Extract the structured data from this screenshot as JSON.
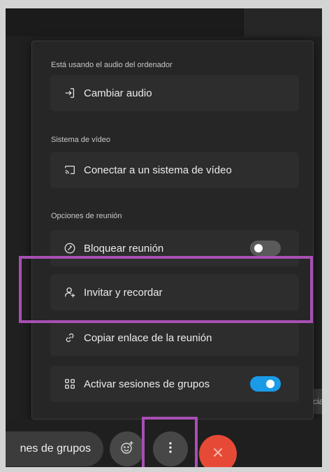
{
  "menu": {
    "audio_section": {
      "label": "Está usando el audio del ordenador",
      "item_label": "Cambiar audio",
      "icon": "switch-audio-icon"
    },
    "video_section": {
      "label": "Sistema de vídeo",
      "item_label": "Conectar a un sistema de vídeo",
      "icon": "cast-screen-icon"
    },
    "meeting_section": {
      "label": "Opciones de reunión",
      "items": [
        {
          "label": "Bloquear reunión",
          "icon": "lock-circle-icon",
          "toggle": "off"
        },
        {
          "label": "Invitar y recordar",
          "icon": "add-person-icon"
        },
        {
          "label": "Copiar enlace de la reunión",
          "icon": "link-icon"
        },
        {
          "label": "Activar sesiones de grupos",
          "icon": "breakout-grid-icon",
          "toggle": "on"
        }
      ]
    }
  },
  "bottom_bar": {
    "breakout_label": "nes de grupos",
    "reactions_icon": "emoji-add-icon",
    "more_icon": "more-vertical-icon",
    "leave_icon": "close-icon"
  },
  "side_chip_text": "cia",
  "colors": {
    "highlight": "#a84fb4",
    "toggle_on": "#1a9be8",
    "leave_red": "#e64a37"
  }
}
